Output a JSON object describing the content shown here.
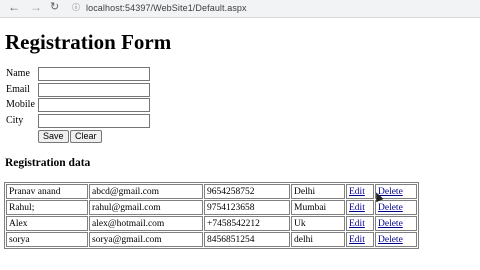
{
  "browser": {
    "back_icon": "arrow-left",
    "forward_icon": "arrow-right",
    "reload_icon": "reload",
    "url": "localhost:54397/WebSite1/Default.aspx"
  },
  "page": {
    "title": "Registration Form",
    "subtitle": "Registration data"
  },
  "form": {
    "name_label": "Name",
    "email_label": "Email",
    "mobile_label": "Mobile",
    "city_label": "City",
    "name_value": "",
    "email_value": "",
    "mobile_value": "",
    "city_value": "",
    "save_label": "Save",
    "clear_label": "Clear"
  },
  "table": {
    "rows": [
      {
        "name": "Pranav anand",
        "email": "abcd@gmail.com",
        "mobile": "9654258752",
        "city": "Delhi",
        "edit": "Edit",
        "delete": "Delete"
      },
      {
        "name": "Rahul;",
        "email": "rahul@gmail.com",
        "mobile": "9754123658",
        "city": "Mumbai",
        "edit": "Edit",
        "delete": "Delete"
      },
      {
        "name": "Alex",
        "email": "alex@hotmail.com",
        "mobile": "+7458542212",
        "city": "Uk",
        "edit": "Edit",
        "delete": "Delete"
      },
      {
        "name": "sorya",
        "email": "sorya@gmail.com",
        "mobile": "8456851254",
        "city": "delhi",
        "edit": "Edit",
        "delete": "Delete"
      }
    ]
  },
  "colors": {
    "link": "#00008b",
    "border": "#808080"
  }
}
